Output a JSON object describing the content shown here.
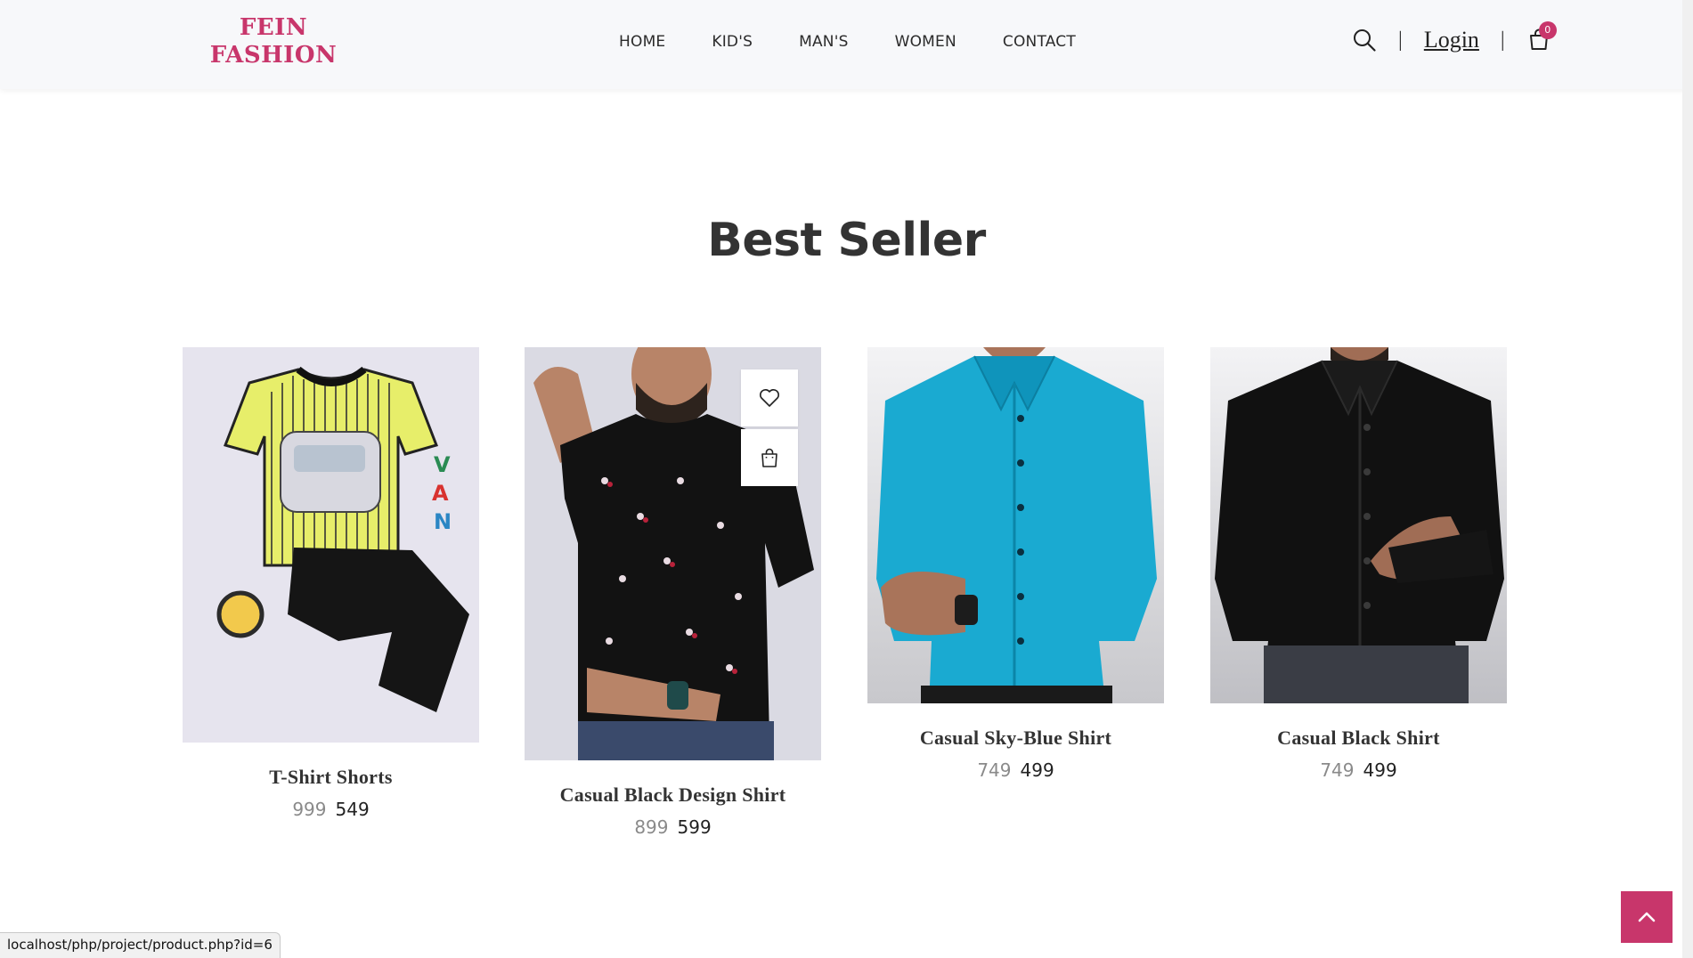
{
  "header": {
    "logo_line1": "FEIN",
    "logo_line2": "FASHION",
    "nav": [
      "HOME",
      "KID'S",
      "MAN'S",
      "WOMEN",
      "CONTACT"
    ],
    "login_label": "Login",
    "separator": "|",
    "cart_count": "0",
    "icons": {
      "search": "search-icon",
      "cart": "shopping-bag-icon"
    }
  },
  "section": {
    "title": "Best Seller"
  },
  "products": [
    {
      "name": "T-Shirt Shorts",
      "old_price": "999",
      "new_price": "549"
    },
    {
      "name": "Casual Black Design Shirt",
      "old_price": "899",
      "new_price": "599"
    },
    {
      "name": "Casual Sky-Blue Shirt",
      "old_price": "749",
      "new_price": "499"
    },
    {
      "name": "Casual Black Shirt",
      "old_price": "749",
      "new_price": "499"
    }
  ],
  "status_bar": {
    "url": "localhost/php/project/product.php?id=6"
  },
  "colors": {
    "brand": "#c8366b",
    "text": "#333333",
    "old_price": "#8a8a8a"
  }
}
